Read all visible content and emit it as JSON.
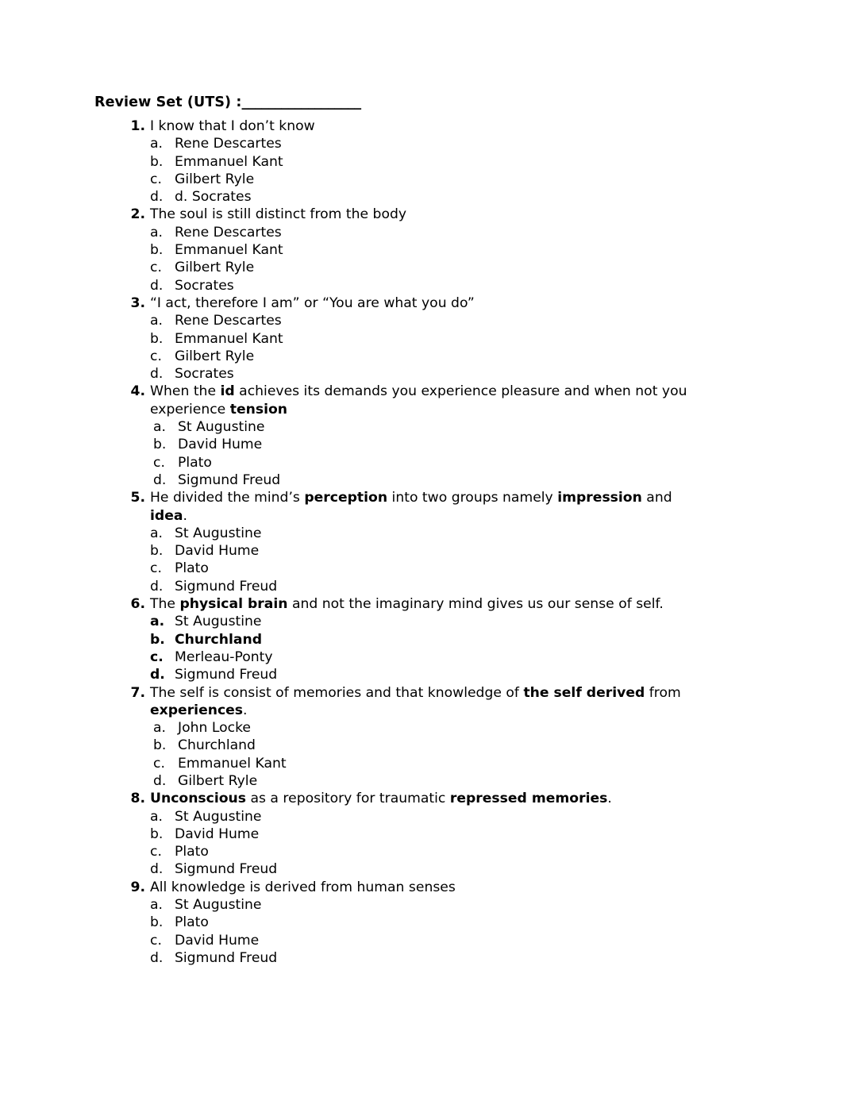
{
  "document": {
    "title_label": "Review Set (UTS) :",
    "title_blank": "__________________"
  },
  "questions": [
    {
      "number": "1.",
      "text": "I know that I don’t know",
      "options_indent": "normal",
      "options": [
        {
          "label": "a.",
          "text": "Rene Descartes",
          "label_bold": false,
          "text_bold": false
        },
        {
          "label": "b.",
          "text": "Emmanuel Kant",
          "label_bold": false,
          "text_bold": false
        },
        {
          "label": "c.",
          "text": "Gilbert Ryle",
          "label_bold": false,
          "text_bold": false
        },
        {
          "label": "d.",
          "text": "d.  Socrates",
          "label_bold": false,
          "text_bold": false
        }
      ]
    },
    {
      "number": "2.",
      "text": "The soul is still distinct from the body",
      "options_indent": "normal",
      "options": [
        {
          "label": "a.",
          "text": "Rene Descartes",
          "label_bold": false,
          "text_bold": false
        },
        {
          "label": "b.",
          "text": "Emmanuel Kant",
          "label_bold": false,
          "text_bold": false
        },
        {
          "label": "c.",
          "text": "Gilbert Ryle",
          "label_bold": false,
          "text_bold": false
        },
        {
          "label": "d.",
          "text": "Socrates",
          "label_bold": false,
          "text_bold": false
        }
      ]
    },
    {
      "number": "3.",
      "text": "“I act, therefore I am” or “You are what you do”",
      "options_indent": "normal",
      "options": [
        {
          "label": "a.",
          "text": "Rene Descartes",
          "label_bold": false,
          "text_bold": false
        },
        {
          "label": "b.",
          "text": "Emmanuel Kant",
          "label_bold": false,
          "text_bold": false
        },
        {
          "label": "c.",
          "text": "Gilbert Ryle",
          "label_bold": false,
          "text_bold": false
        },
        {
          "label": "d.",
          "text": "Socrates",
          "label_bold": false,
          "text_bold": false
        }
      ]
    },
    {
      "number": "4.",
      "text_runs": [
        {
          "t": "When the ",
          "b": false
        },
        {
          "t": "id",
          "b": true
        },
        {
          "t": " achieves its demands you experience pleasure and when not you experience ",
          "b": false
        },
        {
          "t": "tension",
          "b": true
        }
      ],
      "options_indent": "extra",
      "options": [
        {
          "label": "a.",
          "text": "St Augustine",
          "label_bold": false,
          "text_bold": false
        },
        {
          "label": "b.",
          "text": "David Hume",
          "label_bold": false,
          "text_bold": false
        },
        {
          "label": "c.",
          "text": "Plato",
          "label_bold": false,
          "text_bold": false
        },
        {
          "label": "d.",
          "text": "Sigmund Freud",
          "label_bold": false,
          "text_bold": false
        }
      ]
    },
    {
      "number": "5.",
      "text_runs": [
        {
          "t": "He divided the mind’s ",
          "b": false
        },
        {
          "t": "perception",
          "b": true
        },
        {
          "t": " into two groups namely ",
          "b": false
        },
        {
          "t": "impression",
          "b": true
        },
        {
          "t": " and ",
          "b": false
        },
        {
          "t": "idea",
          "b": true
        },
        {
          "t": ".",
          "b": false
        }
      ],
      "options_indent": "normal",
      "options": [
        {
          "label": "a.",
          "text": "St Augustine",
          "label_bold": false,
          "text_bold": false
        },
        {
          "label": "b.",
          "text": "David Hume",
          "label_bold": false,
          "text_bold": false
        },
        {
          "label": "c.",
          "text": "Plato",
          "label_bold": false,
          "text_bold": false
        },
        {
          "label": "d.",
          "text": "Sigmund Freud",
          "label_bold": false,
          "text_bold": false
        }
      ]
    },
    {
      "number": "6.",
      "text_runs": [
        {
          "t": "The ",
          "b": false
        },
        {
          "t": "physical brain",
          "b": true
        },
        {
          "t": " and not the imaginary mind gives us our sense of self.",
          "b": false
        }
      ],
      "options_indent": "normal",
      "options": [
        {
          "label": "a.",
          "text": "St Augustine",
          "label_bold": true,
          "text_bold": false
        },
        {
          "label": "b.",
          "text": "Churchland",
          "label_bold": true,
          "text_bold": true
        },
        {
          "label": "c.",
          "text": "Merleau-Ponty",
          "label_bold": true,
          "text_bold": false
        },
        {
          "label": "d.",
          "text": "Sigmund Freud",
          "label_bold": true,
          "text_bold": false
        }
      ]
    },
    {
      "number": "7.",
      "text_runs": [
        {
          "t": "The self is consist of memories and that knowledge of ",
          "b": false
        },
        {
          "t": "the self derived",
          "b": true
        },
        {
          "t": " from ",
          "b": false
        },
        {
          "t": "experiences",
          "b": true
        },
        {
          "t": ".",
          "b": false
        }
      ],
      "options_indent": "extra",
      "options": [
        {
          "label": "a.",
          "text": "John Locke",
          "label_bold": false,
          "text_bold": false
        },
        {
          "label": "b.",
          "text": "Churchland",
          "label_bold": false,
          "text_bold": false
        },
        {
          "label": "c.",
          "text": "Emmanuel Kant",
          "label_bold": false,
          "text_bold": false
        },
        {
          "label": "d.",
          "text": "Gilbert Ryle",
          "label_bold": false,
          "text_bold": false
        }
      ]
    },
    {
      "number": "8.",
      "text_runs": [
        {
          "t": "Unconscious",
          "b": true
        },
        {
          "t": " as a repository for traumatic ",
          "b": false
        },
        {
          "t": "repressed memories",
          "b": true
        },
        {
          "t": ".",
          "b": false
        }
      ],
      "options_indent": "normal",
      "options": [
        {
          "label": "a.",
          "text": "St Augustine",
          "label_bold": false,
          "text_bold": false
        },
        {
          "label": "b.",
          "text": "David Hume",
          "label_bold": false,
          "text_bold": false
        },
        {
          "label": "c.",
          "text": "Plato",
          "label_bold": false,
          "text_bold": false
        },
        {
          "label": "d.",
          "text": "Sigmund Freud",
          "label_bold": false,
          "text_bold": false
        }
      ]
    },
    {
      "number": "9.",
      "text": "All knowledge is derived from human senses",
      "options_indent": "normal",
      "options": [
        {
          "label": "a.",
          "text": "St Augustine",
          "label_bold": false,
          "text_bold": false
        },
        {
          "label": "b.",
          "text": "Plato",
          "label_bold": false,
          "text_bold": false
        },
        {
          "label": "c.",
          "text": "David Hume",
          "label_bold": false,
          "text_bold": false
        },
        {
          "label": "d.",
          "text": "Sigmund Freud",
          "label_bold": false,
          "text_bold": false
        }
      ]
    }
  ]
}
